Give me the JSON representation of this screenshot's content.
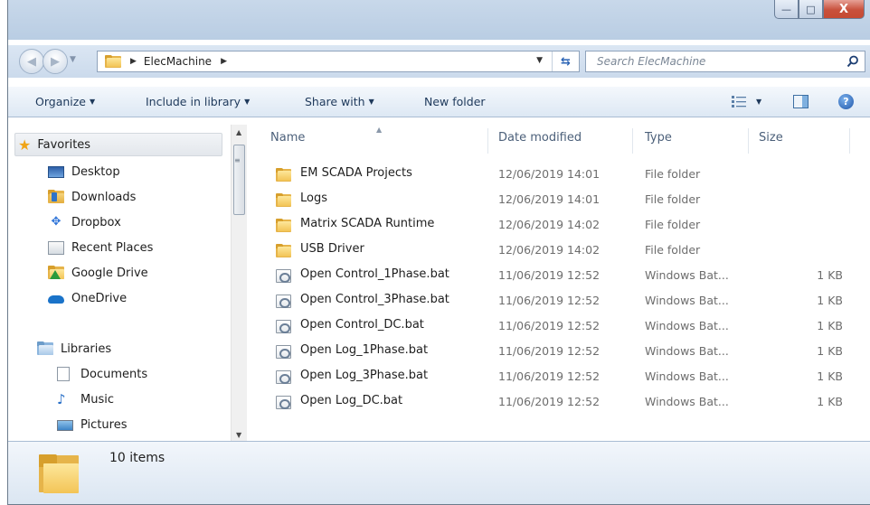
{
  "window": {
    "caption_buttons": {
      "minimize": "—",
      "maximize": "□",
      "close": "X"
    }
  },
  "address": {
    "crumb": "ElecMachine",
    "search_placeholder": "Search ElecMachine"
  },
  "toolbar": {
    "organize": "Organize",
    "include_in_library": "Include in library",
    "share_with": "Share with",
    "new_folder": "New folder",
    "help": "?"
  },
  "nav": {
    "favorites": "Favorites",
    "favorites_items": [
      "Desktop",
      "Downloads",
      "Dropbox",
      "Recent Places",
      "Google Drive",
      "OneDrive"
    ],
    "libraries": "Libraries",
    "libraries_items": [
      "Documents",
      "Music",
      "Pictures"
    ]
  },
  "columns": {
    "name": "Name",
    "date": "Date modified",
    "type": "Type",
    "size": "Size"
  },
  "files": [
    {
      "name": "EM SCADA Projects",
      "date": "12/06/2019 14:01",
      "type": "File folder",
      "size": "",
      "kind": "folder"
    },
    {
      "name": "Logs",
      "date": "12/06/2019 14:01",
      "type": "File folder",
      "size": "",
      "kind": "folder"
    },
    {
      "name": "Matrix SCADA Runtime",
      "date": "12/06/2019 14:02",
      "type": "File folder",
      "size": "",
      "kind": "folder"
    },
    {
      "name": "USB Driver",
      "date": "12/06/2019 14:02",
      "type": "File folder",
      "size": "",
      "kind": "folder"
    },
    {
      "name": "Open Control_1Phase.bat",
      "date": "11/06/2019 12:52",
      "type": "Windows Bat...",
      "size": "1 KB",
      "kind": "bat"
    },
    {
      "name": "Open Control_3Phase.bat",
      "date": "11/06/2019 12:52",
      "type": "Windows Bat...",
      "size": "1 KB",
      "kind": "bat"
    },
    {
      "name": "Open Control_DC.bat",
      "date": "11/06/2019 12:52",
      "type": "Windows Bat...",
      "size": "1 KB",
      "kind": "bat"
    },
    {
      "name": "Open Log_1Phase.bat",
      "date": "11/06/2019 12:52",
      "type": "Windows Bat...",
      "size": "1 KB",
      "kind": "bat"
    },
    {
      "name": "Open Log_3Phase.bat",
      "date": "11/06/2019 12:52",
      "type": "Windows Bat...",
      "size": "1 KB",
      "kind": "bat"
    },
    {
      "name": "Open Log_DC.bat",
      "date": "11/06/2019 12:52",
      "type": "Windows Bat...",
      "size": "1 KB",
      "kind": "bat"
    }
  ],
  "status": {
    "item_count": "10 items"
  }
}
